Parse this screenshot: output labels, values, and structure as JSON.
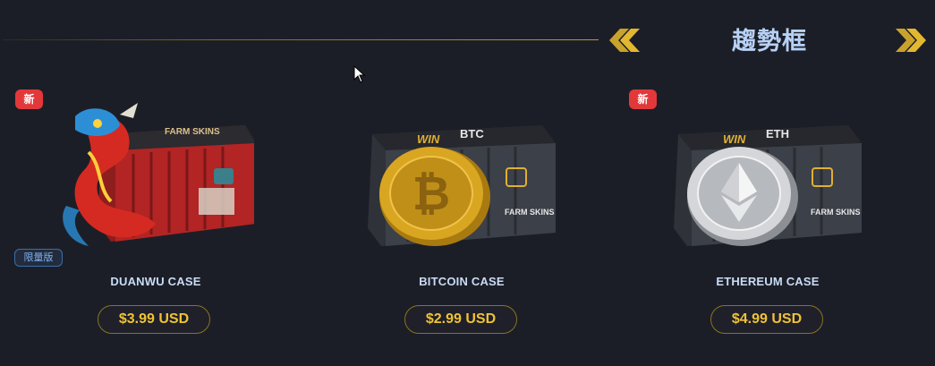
{
  "section": {
    "title": "趨勢框"
  },
  "colors": {
    "accent_gold": "#f0c235",
    "badge_new": "#e2383a",
    "title_blue": "#b7d1f6"
  },
  "cases": [
    {
      "name": "DUANWU CASE",
      "price": "$3.99 USD",
      "new_badge": "新",
      "limited_badge": "限量版",
      "coin_label": "",
      "icon": "dragon-case-image"
    },
    {
      "name": "BITCOIN CASE",
      "price": "$2.99 USD",
      "new_badge": "",
      "limited_badge": "",
      "coin_label": "BTC",
      "icon": "bitcoin-case-image"
    },
    {
      "name": "ETHEREUM CASE",
      "price": "$4.99 USD",
      "new_badge": "新",
      "limited_badge": "",
      "coin_label": "ETH",
      "icon": "ethereum-case-image"
    }
  ],
  "case_art": {
    "win_text": "WIN",
    "brand_text": "FARM SKINS"
  }
}
